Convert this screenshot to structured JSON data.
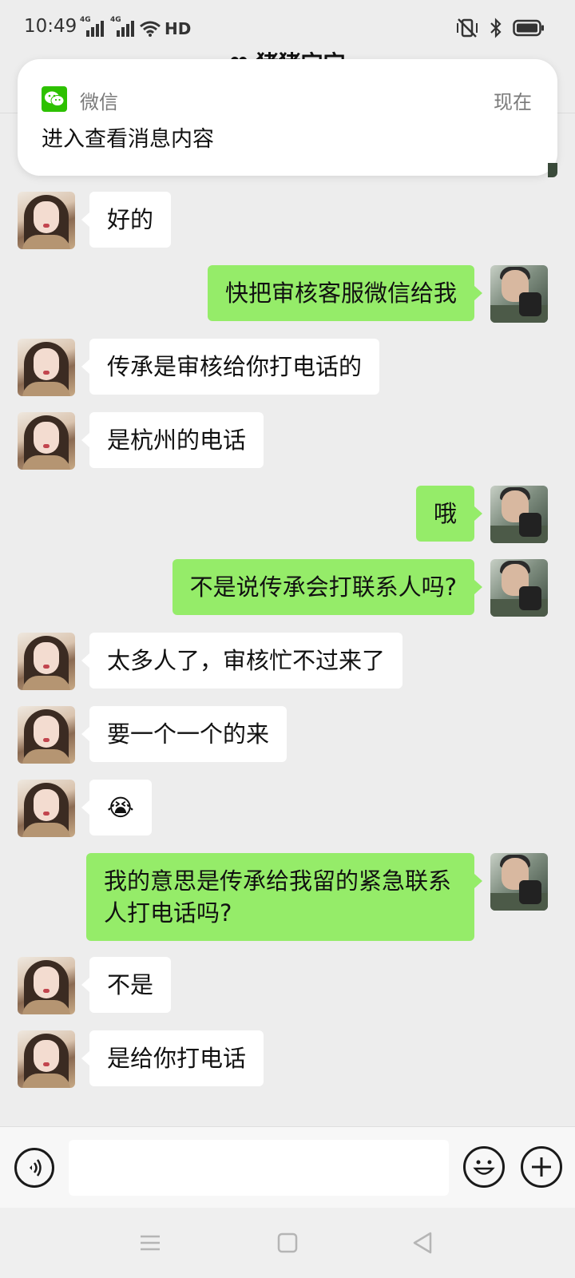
{
  "status_bar": {
    "time": "10:49",
    "signal1_label": "4G",
    "signal2_label": "4G",
    "hd_label": "HD"
  },
  "chat": {
    "title": "❤ 猪猪宝宝"
  },
  "notification": {
    "app_name": "微信",
    "time": "现在",
    "body": "进入查看消息内容",
    "icon": "wechat-icon"
  },
  "messages": [
    {
      "side": "left",
      "text": "好的"
    },
    {
      "side": "right",
      "text": "快把审核客服微信给我"
    },
    {
      "side": "left",
      "text": "传承是审核给你打电话的"
    },
    {
      "side": "left",
      "text": "是杭州的电话"
    },
    {
      "side": "right",
      "text": "哦"
    },
    {
      "side": "right",
      "text": "不是说传承会打联系人吗?"
    },
    {
      "side": "left",
      "text": "太多人了，审核忙不过来了"
    },
    {
      "side": "left",
      "text": "要一个一个的来"
    },
    {
      "side": "left",
      "text": "😭"
    },
    {
      "side": "right",
      "text": "我的意思是传承给我留的紧急联系人打电话吗?"
    },
    {
      "side": "left",
      "text": "不是"
    },
    {
      "side": "left",
      "text": "是给你打电话"
    }
  ],
  "input_bar": {
    "placeholder": "",
    "voice_icon": "voice-icon",
    "emoji_icon": "emoji-icon",
    "plus_icon": "plus-icon"
  },
  "nav_bar": {
    "menu_icon": "menu-icon",
    "home_icon": "home-icon",
    "back_icon": "back-icon"
  },
  "colors": {
    "background": "#ededed",
    "bubble_self": "#95ec69",
    "bubble_other": "#ffffff",
    "wechat_green": "#2dc100"
  }
}
